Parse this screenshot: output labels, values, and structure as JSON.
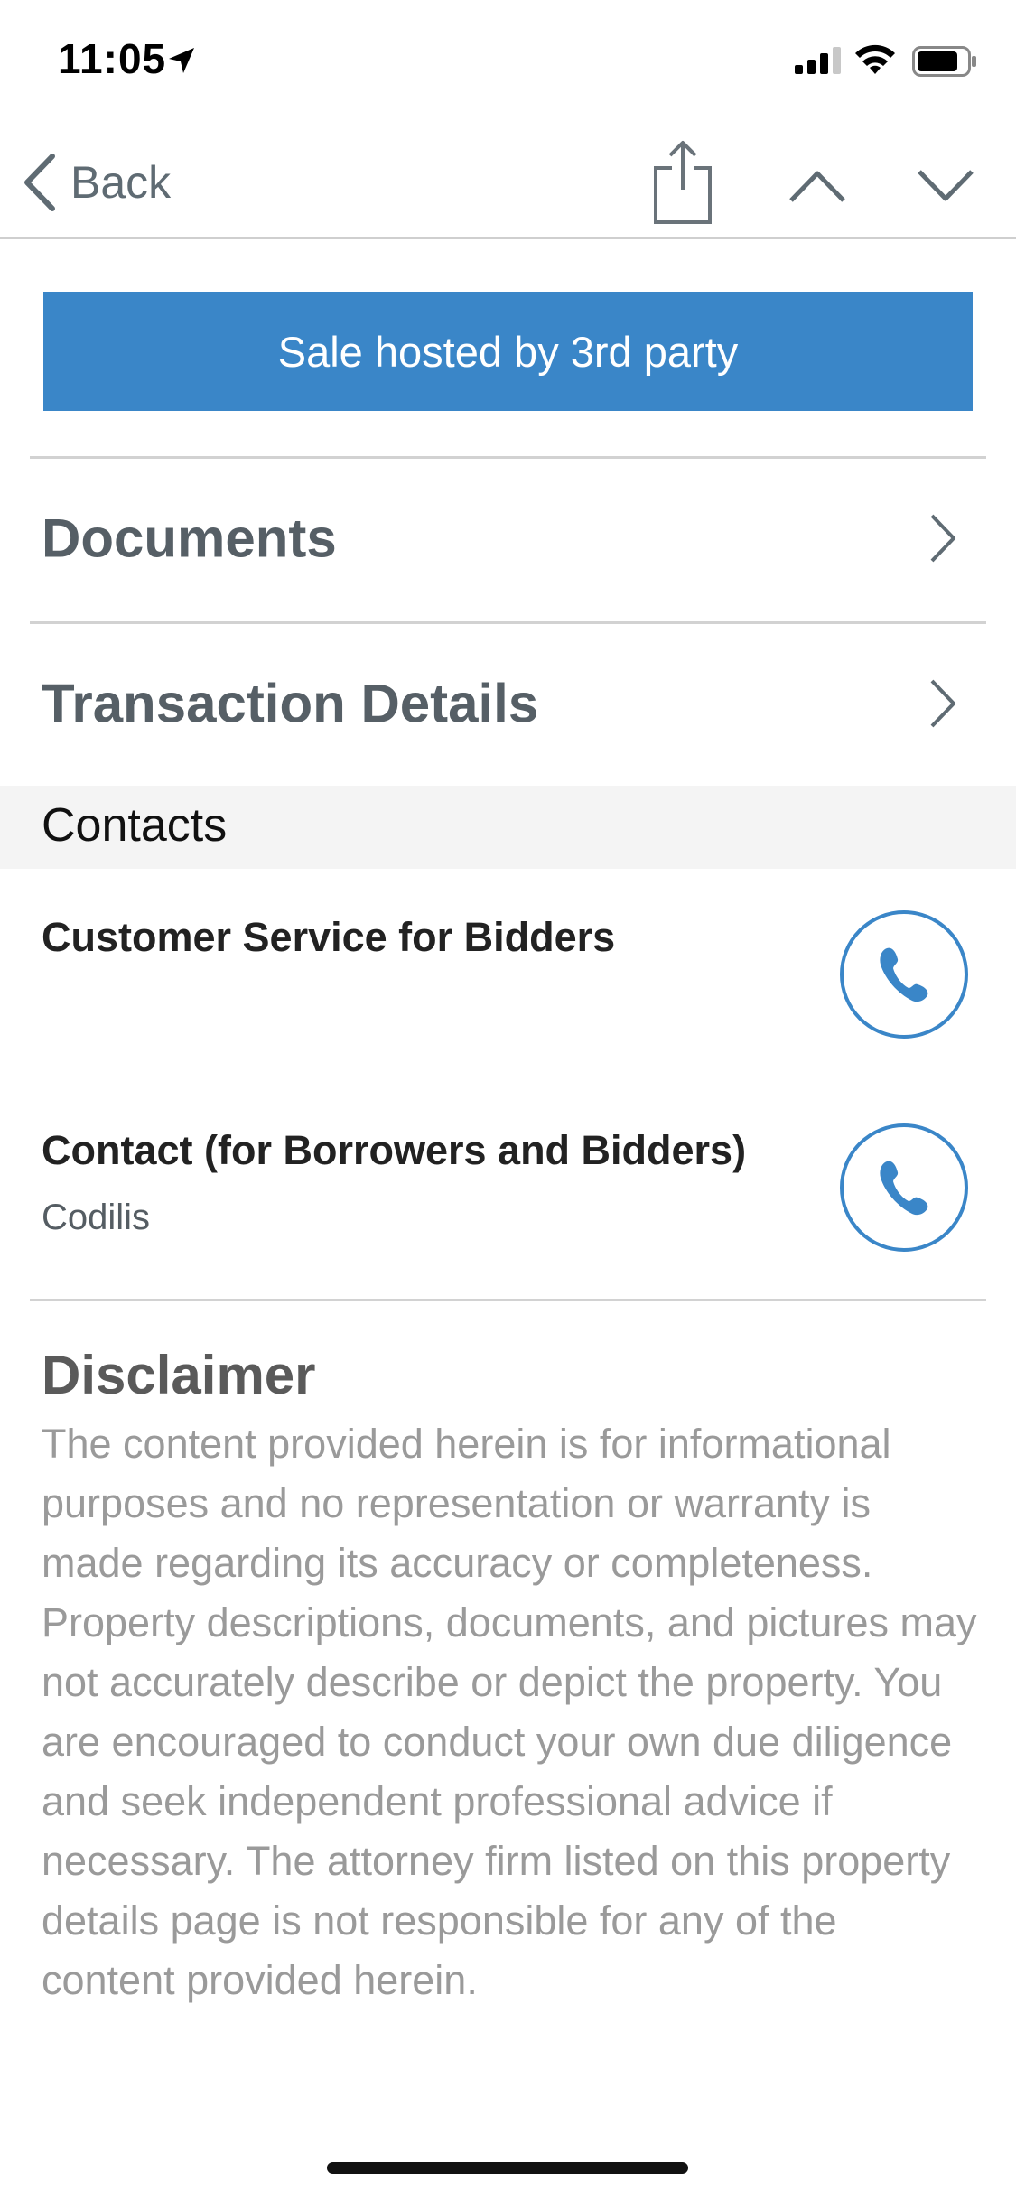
{
  "status_bar": {
    "time": "11:05"
  },
  "nav": {
    "back_label": "Back"
  },
  "banner": {
    "label": "Sale hosted by 3rd party",
    "color": "#3a86c8"
  },
  "rows": [
    {
      "label": "Documents"
    },
    {
      "label": "Transaction Details"
    }
  ],
  "contacts": {
    "header": "Contacts",
    "items": [
      {
        "name": "Customer Service for Bidders",
        "sub": ""
      },
      {
        "name": "Contact (for Borrowers and Bidders)",
        "sub": "Codilis"
      }
    ]
  },
  "disclaimer": {
    "title": "Disclaimer",
    "text": "The content provided herein is for informational purposes and no representation or warranty is made regarding its accuracy or completeness. Property descriptions, documents, and pictures may not accurately describe or depict the property. You are encouraged to conduct your own due diligence and seek independent professional advice if necessary. The attorney firm listed on this property details page is not responsible for any of the content provided herein."
  },
  "icons": [
    "location-arrow-icon",
    "signal-icon",
    "wifi-icon",
    "battery-icon",
    "back-chevron-icon",
    "share-icon",
    "chevron-up-icon",
    "chevron-down-icon",
    "chevron-right-icon",
    "phone-icon"
  ]
}
